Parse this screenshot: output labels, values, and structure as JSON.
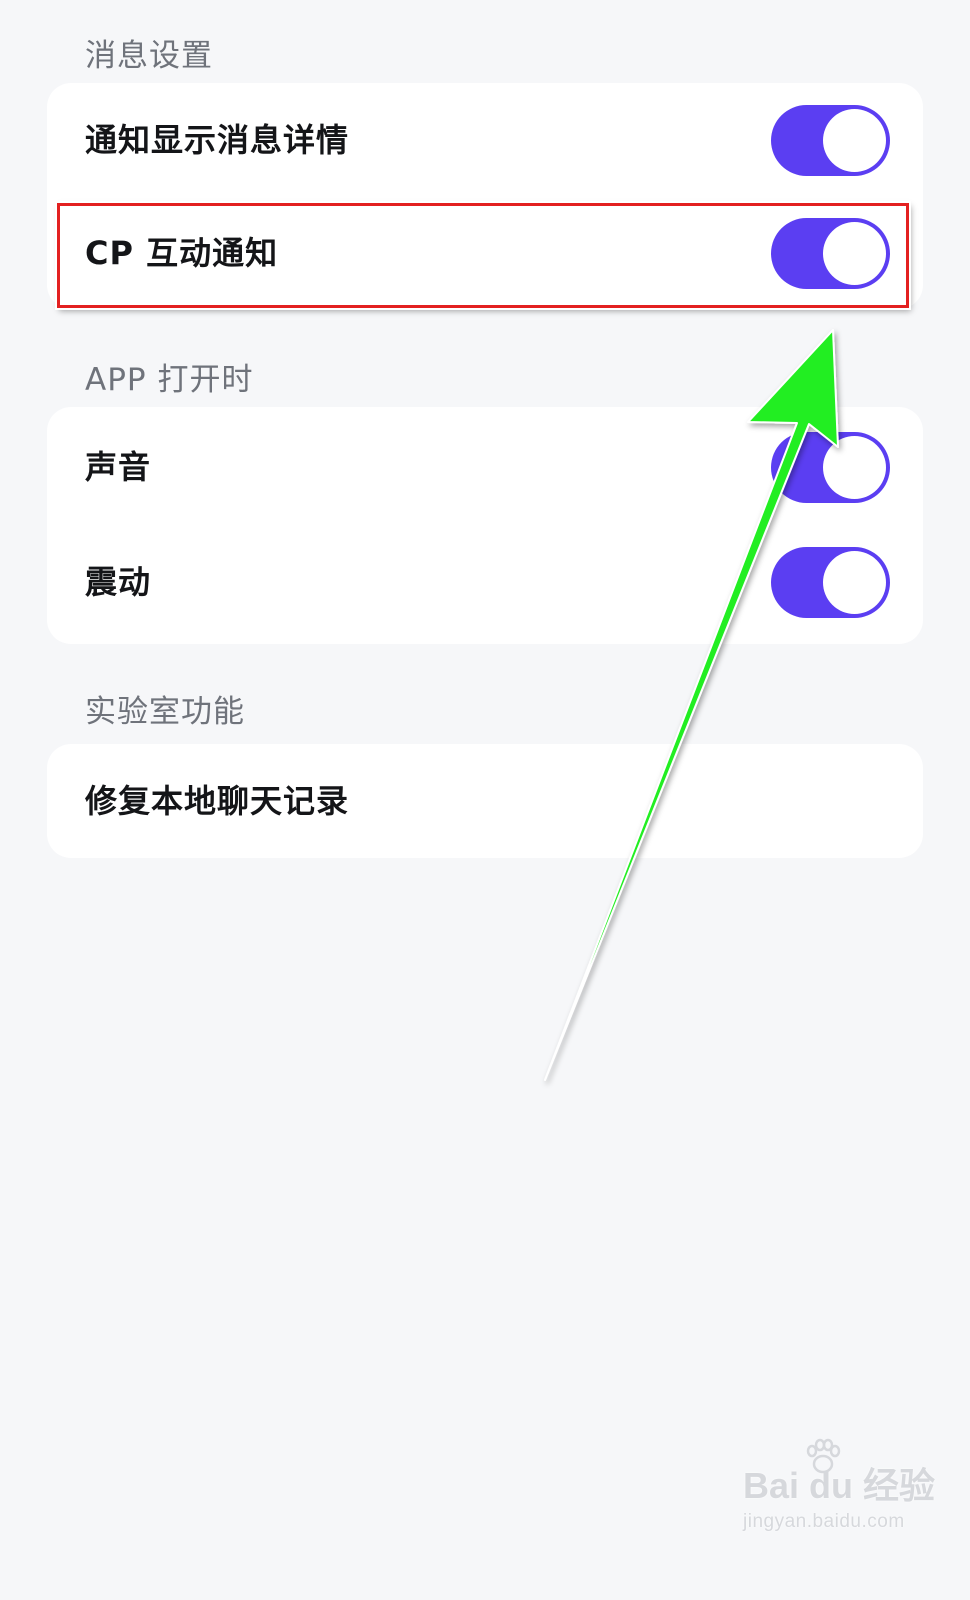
{
  "sections": [
    {
      "header": "消息设置",
      "rows": [
        {
          "label": "通知显示消息详情",
          "toggle": true
        },
        {
          "label": "CP 互动通知",
          "toggle": true
        }
      ]
    },
    {
      "header": "APP 打开时",
      "rows": [
        {
          "label": "声音",
          "toggle": true
        },
        {
          "label": "震动",
          "toggle": true
        }
      ]
    },
    {
      "header": "实验室功能",
      "rows": [
        {
          "label": "修复本地聊天记录"
        }
      ]
    }
  ],
  "colors": {
    "background": "#f6f7f9",
    "card": "#ffffff",
    "toggle_on": "#5b3ef2",
    "highlight_box": "#e32020",
    "arrow": "#22ee22"
  },
  "icons": [
    "toggle-switch",
    "annotation-arrow",
    "baidu-paw-logo"
  ],
  "watermark": {
    "logo_text": "Bai du 经验",
    "url": "jingyan.baidu.com"
  }
}
